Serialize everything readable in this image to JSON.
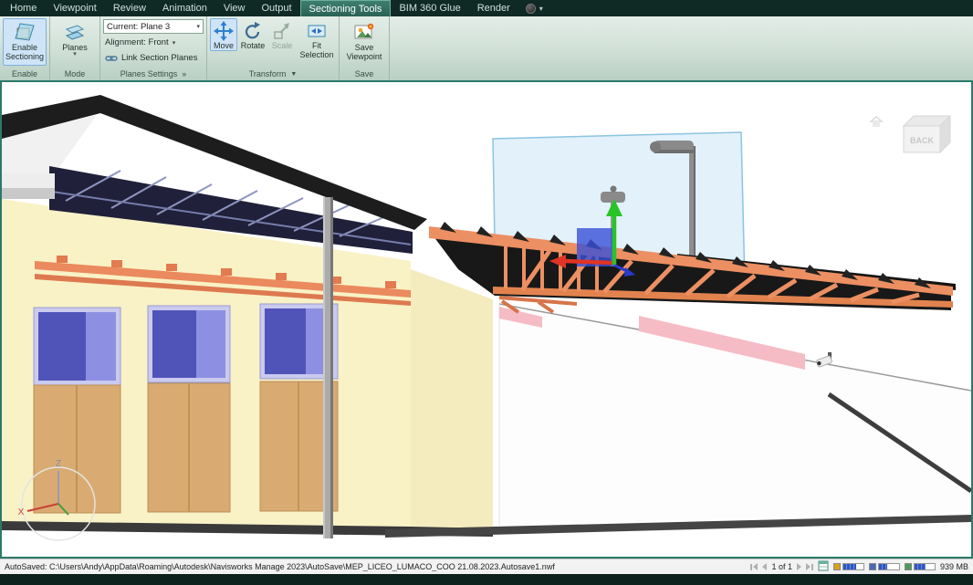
{
  "colors": {
    "frame_teal": "#2b7a6a",
    "active_highlight": "#cfe4f7",
    "truss_orange": "#ec8f62",
    "wall_cream": "#f9f2c6",
    "section_plane_blue": "#bfe0f3",
    "gizmo_green": "#28c428",
    "gizmo_red": "#e03424",
    "gizmo_blue": "#3a50d8"
  },
  "menubar": {
    "tabs": [
      "Home",
      "Viewpoint",
      "Review",
      "Animation",
      "View",
      "Output",
      "Sectioning Tools",
      "BIM 360 Glue",
      "Render"
    ],
    "active_tab": "Sectioning Tools",
    "overflow_caret": "▾"
  },
  "ribbon": {
    "enable": {
      "group_label": "Enable",
      "button_label": "Enable Sectioning"
    },
    "mode": {
      "group_label": "Mode",
      "button_label": "Planes",
      "caret": "▾"
    },
    "planes_settings": {
      "group_label": "Planes Settings",
      "expander": "»",
      "current_value": "Current: Plane 3",
      "alignment_value": "Alignment: Front",
      "link_label": "Link Section Planes",
      "caret": "▾"
    },
    "transform": {
      "group_label": "Transform",
      "caret": "▼",
      "move_label": "Move",
      "rotate_label": "Rotate",
      "scale_label": "Scale",
      "fit_label": "Fit Selection"
    },
    "save": {
      "group_label": "Save",
      "button_label": "Save Viewpoint"
    }
  },
  "viewport": {
    "navcube_label": "BACK",
    "axis_x": "X",
    "axis_z": "Z"
  },
  "statusbar": {
    "autosave_text": "AutoSaved: C:\\Users\\Andy\\AppData\\Roaming\\Autodesk\\Navisworks Manage 2023\\AutoSave\\MEP_LICEO_LUMACO_COO 21.08.2023.Autosave1.nwf",
    "page_indicator": "1 of 1",
    "memory": "939 MB"
  }
}
